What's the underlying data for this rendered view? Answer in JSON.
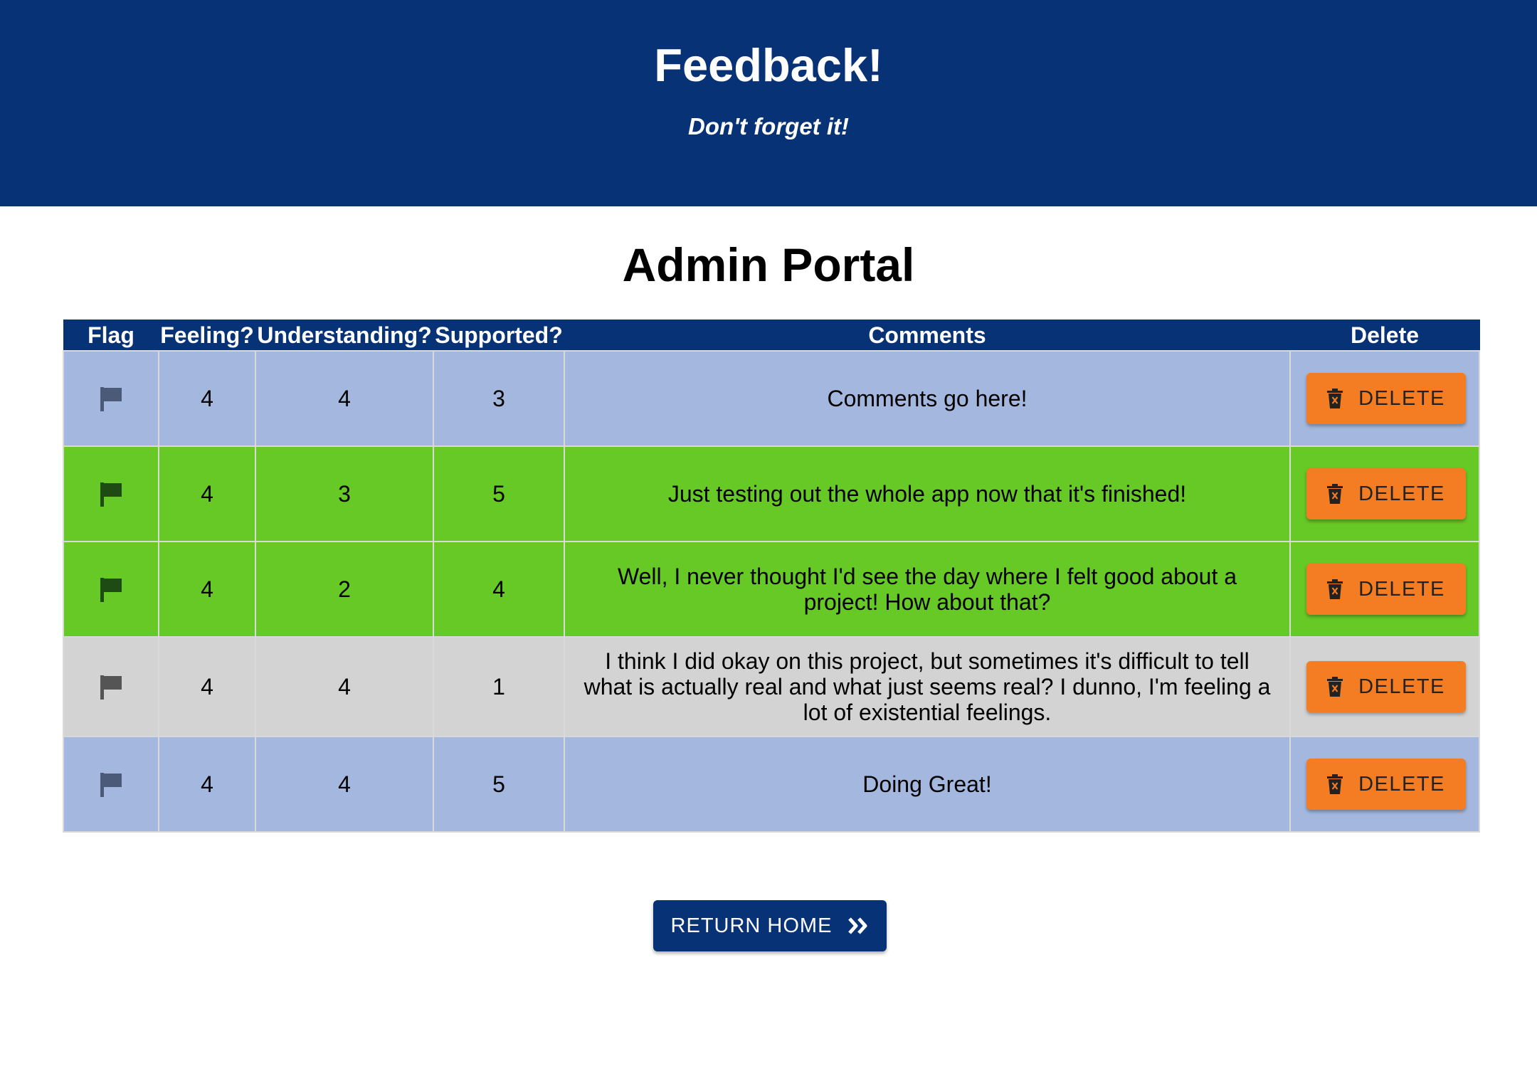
{
  "header": {
    "title": "Feedback!",
    "subtitle": "Don't forget it!"
  },
  "page_title": "Admin Portal",
  "table": {
    "columns": [
      "Flag",
      "Feeling?",
      "Understanding?",
      "Supported?",
      "Comments",
      "Delete"
    ],
    "rows": [
      {
        "feeling": "4",
        "understanding": "4",
        "supported": "3",
        "comments": "Comments go here!",
        "status": "default",
        "delete_label": "DELETE"
      },
      {
        "feeling": "4",
        "understanding": "3",
        "supported": "5",
        "comments": "Just testing out the whole app now that it's finished!",
        "status": "flagged-green",
        "delete_label": "DELETE"
      },
      {
        "feeling": "4",
        "understanding": "2",
        "supported": "4",
        "comments": "Well, I never thought I'd see the day where I felt good about a project! How about that?",
        "status": "flagged-green",
        "delete_label": "DELETE"
      },
      {
        "feeling": "4",
        "understanding": "4",
        "supported": "1",
        "comments": "I think I did okay on this project, but sometimes it's difficult to tell what is actually real and what just seems real? I dunno, I'm feeling a lot of existential feelings.",
        "status": "flagged-gray",
        "delete_label": "DELETE"
      },
      {
        "feeling": "4",
        "understanding": "4",
        "supported": "5",
        "comments": "Doing Great!",
        "status": "default",
        "delete_label": "DELETE"
      }
    ]
  },
  "return_button": {
    "label": "RETURN HOME",
    "icon": "double-chevron-right-icon"
  },
  "icons": {
    "flag": "flag-icon",
    "delete": "trash-icon"
  },
  "colors": {
    "header_bg": "#083276",
    "row_default": "#a4b8df",
    "row_green": "#66c925",
    "row_gray": "#d3d3d3",
    "delete_button": "#f47c22"
  }
}
